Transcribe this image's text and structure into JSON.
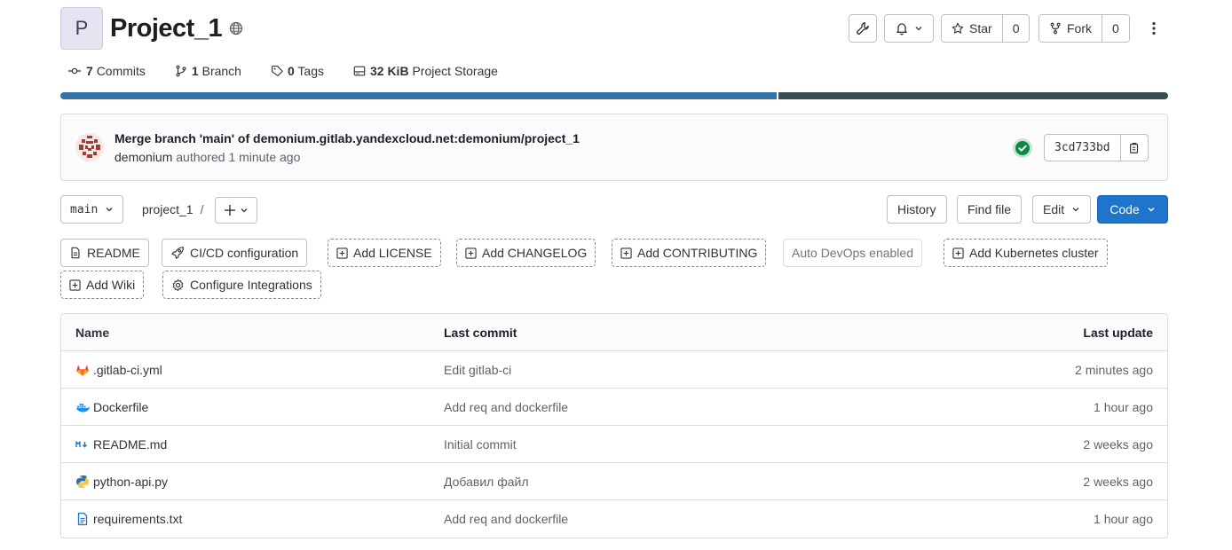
{
  "project": {
    "avatar_letter": "P",
    "name": "Project_1"
  },
  "header_actions": {
    "star_label": "Star",
    "star_count": "0",
    "fork_label": "Fork",
    "fork_count": "0"
  },
  "stats": [
    {
      "value": "7",
      "label": "Commits",
      "icon": "commit-icon"
    },
    {
      "value": "1",
      "label": "Branch",
      "icon": "branch-icon"
    },
    {
      "value": "0",
      "label": "Tags",
      "icon": "tag-icon"
    },
    {
      "value": "32 KiB",
      "label": "Project Storage",
      "icon": "storage-icon"
    }
  ],
  "language_bar": {
    "segments": [
      {
        "color": "#3572a5",
        "fraction": 0.648
      },
      {
        "color": "#384d54",
        "fraction": 0.352
      }
    ]
  },
  "last_commit": {
    "title": "Merge branch 'main' of demonium.gitlab.yandexcloud.net:demonium/project_1",
    "author": "demonium",
    "action": "authored",
    "time": "1 minute ago",
    "sha": "3cd733bd",
    "status_color": "#108548"
  },
  "repo_nav": {
    "branch": "main",
    "breadcrumb": "project_1",
    "separator": "/",
    "history_label": "History",
    "find_file_label": "Find file",
    "edit_label": "Edit",
    "code_label": "Code",
    "code_color": "#1f75cb"
  },
  "shortcuts": [
    {
      "label": "README",
      "style": "solid",
      "icon": "file-icon"
    },
    {
      "label": "CI/CD configuration",
      "style": "solid",
      "icon": "rocket-icon"
    },
    {
      "label": "Add LICENSE",
      "style": "dashed",
      "icon": "plus-square-icon"
    },
    {
      "label": "Add CHANGELOG",
      "style": "dashed",
      "icon": "plus-square-icon"
    },
    {
      "label": "Add CONTRIBUTING",
      "style": "dashed",
      "icon": "plus-square-icon"
    },
    {
      "label": "Auto DevOps enabled",
      "style": "muted",
      "icon": ""
    },
    {
      "label": "Add Kubernetes cluster",
      "style": "dashed",
      "icon": "plus-square-icon"
    },
    {
      "label": "Add Wiki",
      "style": "dashed",
      "icon": "plus-square-icon"
    },
    {
      "label": "Configure Integrations",
      "style": "dashed",
      "icon": "settings-icon"
    }
  ],
  "file_table": {
    "headers": {
      "name": "Name",
      "commit": "Last commit",
      "date": "Last update"
    },
    "rows": [
      {
        "name": ".gitlab-ci.yml",
        "commit": "Edit gitlab-ci",
        "date": "2 minutes ago",
        "icon": "gitlab-icon"
      },
      {
        "name": "Dockerfile",
        "commit": "Add req and dockerfile",
        "date": "1 hour ago",
        "icon": "docker-icon"
      },
      {
        "name": "README.md",
        "commit": "Initial commit",
        "date": "2 weeks ago",
        "icon": "markdown-icon"
      },
      {
        "name": "python-api.py",
        "commit": "Добавил файл",
        "date": "2 weeks ago",
        "icon": "python-icon"
      },
      {
        "name": "requirements.txt",
        "commit": "Add req and dockerfile",
        "date": "1 hour ago",
        "icon": "text-file-icon"
      }
    ]
  }
}
